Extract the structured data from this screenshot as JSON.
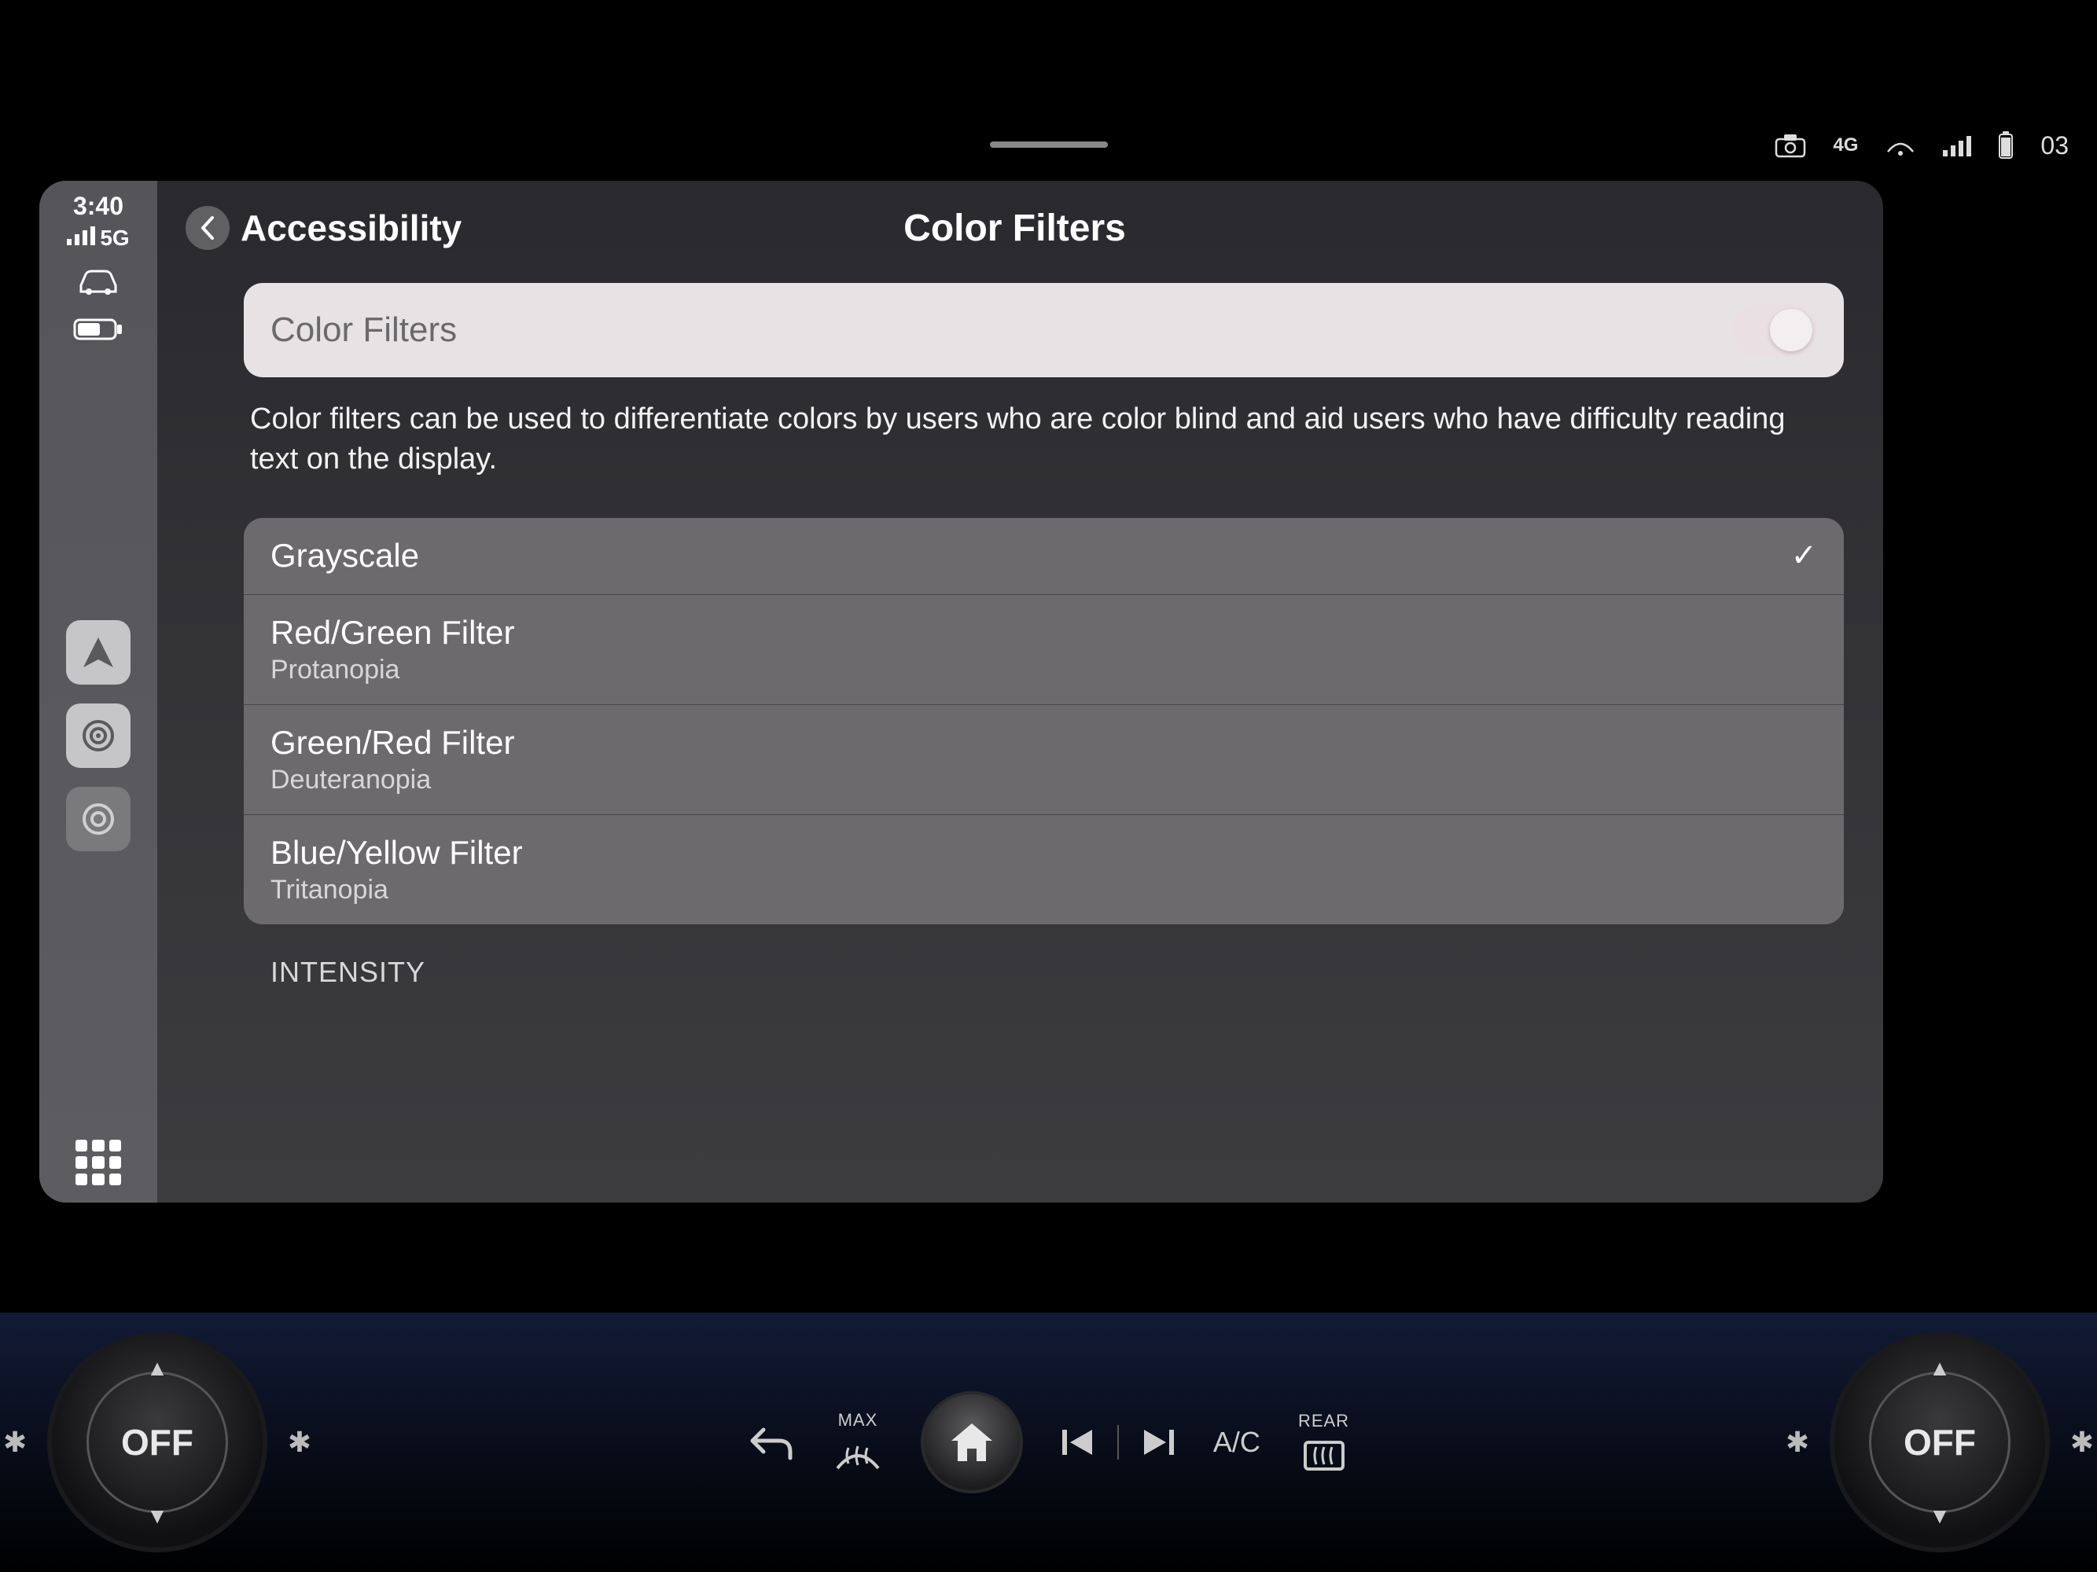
{
  "vehicle_status": {
    "time_fragment": "03"
  },
  "sidebar": {
    "time": "3:40",
    "network": "5G"
  },
  "header": {
    "back_label": "Accessibility",
    "title": "Color Filters"
  },
  "toggle": {
    "label": "Color Filters",
    "on": true
  },
  "description": "Color filters can be used to differentiate colors by users who are color blind and aid users who have difficulty reading text on the display.",
  "options": [
    {
      "primary": "Grayscale",
      "secondary": "",
      "selected": true
    },
    {
      "primary": "Red/Green Filter",
      "secondary": "Protanopia",
      "selected": false
    },
    {
      "primary": "Green/Red Filter",
      "secondary": "Deuteranopia",
      "selected": false
    },
    {
      "primary": "Blue/Yellow Filter",
      "secondary": "Tritanopia",
      "selected": false
    }
  ],
  "section_label": "INTENSITY",
  "vehicle_bar": {
    "left_dial": "OFF",
    "right_dial": "OFF",
    "defrost_max": "MAX",
    "ac": "A/C",
    "rear": "REAR"
  }
}
